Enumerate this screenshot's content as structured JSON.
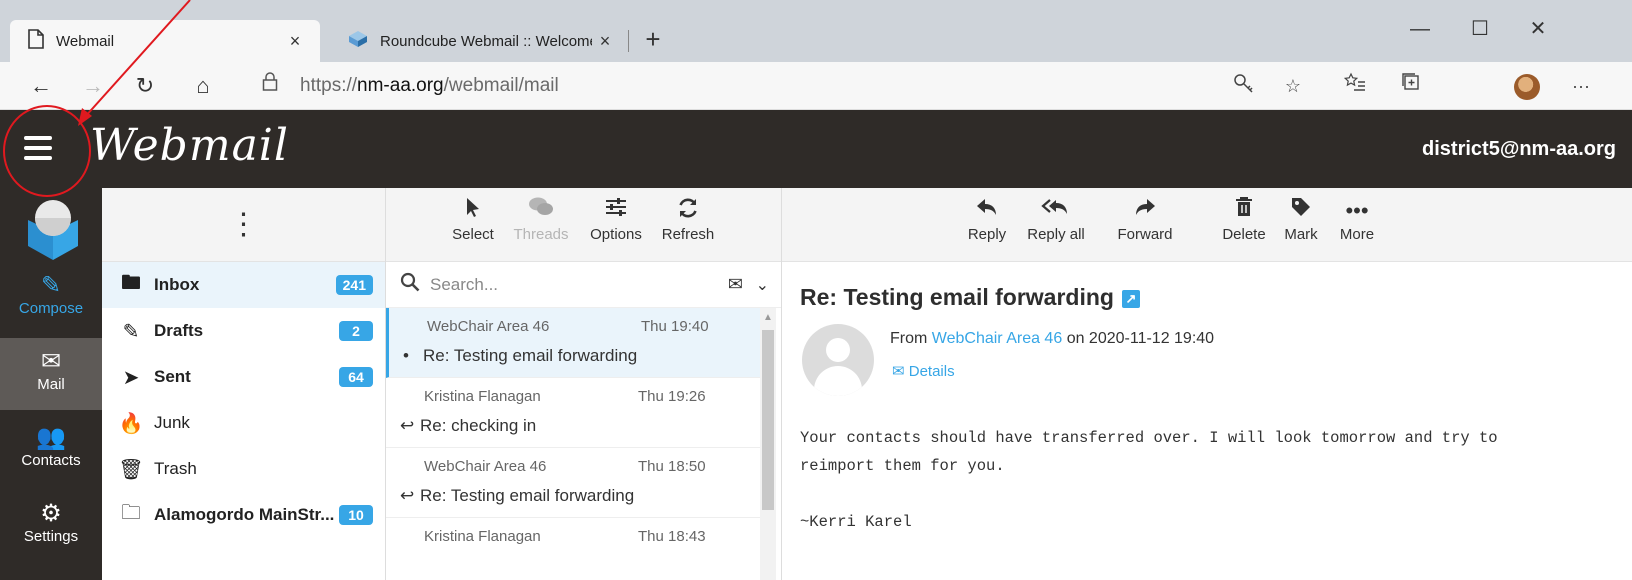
{
  "browser": {
    "tabs": [
      {
        "title": "Webmail",
        "close": "×",
        "icon": "page-icon"
      },
      {
        "title": "Roundcube Webmail :: Welcome",
        "close": "×",
        "icon": "roundcube-icon"
      }
    ],
    "new_tab": "+",
    "window_controls": {
      "minimize": "—",
      "maximize": "☐",
      "close": "✕"
    },
    "nav": {
      "back": "←",
      "forward": "→",
      "refresh": "↻",
      "home": "⌂"
    },
    "url_scheme": "https://",
    "url_host": "nm-aa.org",
    "url_path": "/webmail/mail",
    "more": "···"
  },
  "app": {
    "logo": "Webmail",
    "account": "district5@nm-aa.org"
  },
  "leftnav": {
    "items": [
      {
        "label": "Compose",
        "icon": "compose-icon",
        "glyph": "✎"
      },
      {
        "label": "Mail",
        "icon": "envelope-icon",
        "glyph": "✉"
      },
      {
        "label": "Contacts",
        "icon": "users-icon",
        "glyph": "👥"
      },
      {
        "label": "Settings",
        "icon": "gear-icon",
        "glyph": "⚙"
      }
    ]
  },
  "folders": {
    "menu_glyph": "⋮",
    "items": [
      {
        "name": "Inbox",
        "count": "241",
        "bold": true,
        "glyph": "🖿"
      },
      {
        "name": "Drafts",
        "count": "2",
        "bold": true,
        "glyph": "✎"
      },
      {
        "name": "Sent",
        "count": "64",
        "bold": true,
        "glyph": "➤"
      },
      {
        "name": "Junk",
        "count": "",
        "bold": false,
        "glyph": "🔥"
      },
      {
        "name": "Trash",
        "count": "",
        "bold": false,
        "glyph": "🗑"
      },
      {
        "name": "Alamogordo MainStr...",
        "count": "10",
        "bold": true,
        "glyph": "🗀"
      }
    ]
  },
  "list_toolbar": {
    "select": "Select",
    "threads": "Threads",
    "options": "Options",
    "refresh": "Refresh"
  },
  "search": {
    "placeholder": "Search..."
  },
  "messages": [
    {
      "from": "WebChair Area 46",
      "date": "Thu 19:40",
      "subject": "Re: Testing email forwarding",
      "marker": "•",
      "selected": true
    },
    {
      "from": "Kristina Flanagan",
      "date": "Thu 19:26",
      "subject": "Re: checking in",
      "marker": "↩",
      "selected": false
    },
    {
      "from": "WebChair Area 46",
      "date": "Thu 18:50",
      "subject": "Re: Testing email forwarding",
      "marker": "↩",
      "selected": false
    },
    {
      "from": "Kristina Flanagan",
      "date": "Thu 18:43",
      "subject": "",
      "marker": "",
      "selected": false
    }
  ],
  "reader_toolbar": {
    "reply": "Reply",
    "reply_all": "Reply all",
    "forward": "Forward",
    "delete": "Delete",
    "mark": "Mark",
    "more": "More"
  },
  "email": {
    "subject": "Re: Testing email forwarding",
    "from_prefix": "From",
    "from_name": "WebChair Area 46",
    "on_date": "on 2020-11-12 19:40",
    "details": "Details",
    "body": "Your contacts should have transferred over. I will look tomorrow and try to\nreimport them for you.\n\n~Kerri Karel"
  },
  "colors": {
    "accent": "#37a6e6",
    "header_bg": "#2f2b28",
    "annotation": "#e0191f"
  }
}
